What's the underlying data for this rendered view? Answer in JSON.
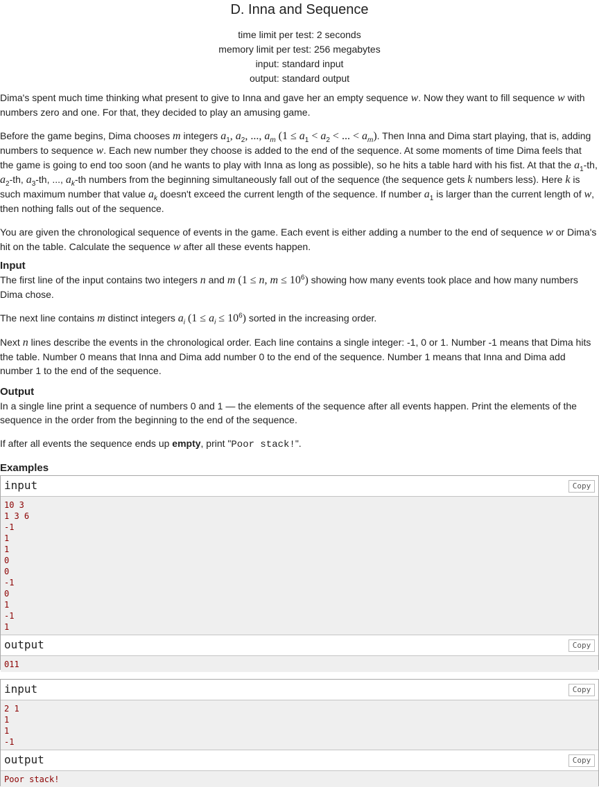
{
  "header": {
    "title": "D. Inna and Sequence",
    "time_limit": "time limit per test: 2 seconds",
    "memory_limit": "memory limit per test: 256 megabytes",
    "input": "input: standard input",
    "output": "output: standard output"
  },
  "statement": {
    "p1_a": "Dima's spent much time thinking what present to give to Inna and gave her an empty sequence ",
    "p1_b": ". Now they want to fill sequence ",
    "p1_c": " with numbers zero and one. For that, they decided to play an amusing game.",
    "p2_a": "Before the game begins, Dima chooses ",
    "p2_b": " integers ",
    "p2_c": ". Then Inna and Dima start playing, that is, adding numbers to sequence ",
    "p2_d": ". Each new number they choose is added to the end of the sequence. At some moments of time Dima feels that the game is going to end too soon (and he wants to play with Inna as long as possible), so he hits a table hard with his fist. At that the ",
    "p2_e": "-th, ",
    "p2_f": "-th, ",
    "p2_g": "-th, ..., ",
    "p2_h": "-th numbers from the beginning simultaneously fall out of the sequence (the sequence gets ",
    "p2_i": " numbers less). Here ",
    "p2_j": " is such maximum number that value ",
    "p2_k": " doesn't exceed the current length of the sequence. If number ",
    "p2_l": " is larger than the current length of ",
    "p2_m": ", then nothing falls out of the sequence.",
    "p3_a": "You are given the chronological sequence of events in the game. Each event is either adding a number to the end of sequence ",
    "p3_b": " or Dima's hit on the table. Calculate the sequence ",
    "p3_c": " after all these events happen."
  },
  "input_section": {
    "title": "Input",
    "p1_a": "The first line of the input contains two integers ",
    "p1_b": " and ",
    "p1_c": " showing how many events took place and how many numbers Dima chose.",
    "p2_a": "The next line contains ",
    "p2_b": " distinct integers ",
    "p2_c": " sorted in the increasing order.",
    "p3_a": "Next ",
    "p3_b": " lines describe the events in the chronological order. Each line contains a single integer: -1, 0 or 1. Number -1 means that Dima hits the table. Number 0 means that Inna and Dima add number 0 to the end of the sequence. Number 1 means that Inna and Dima add number 1 to the end of the sequence."
  },
  "output_section": {
    "title": "Output",
    "p1": "In a single line print a sequence of numbers 0 and 1 — the elements of the sequence after all events happen. Print the elements of the sequence in the order from the beginning to the end of the sequence.",
    "p2_a": "If after all events the sequence ends up ",
    "p2_b": "empty",
    "p2_c": ", print \"",
    "p2_d": "Poor stack!",
    "p2_e": "\"."
  },
  "examples": {
    "title": "Examples",
    "copy_label": "Copy",
    "input_label": "input",
    "output_label": "output",
    "ex1_input": [
      "10 3",
      "1 3 6",
      "-1",
      "1",
      "1",
      "0",
      "0",
      "-1",
      "0",
      "1",
      "-1",
      "1"
    ],
    "ex1_output": [
      "011"
    ],
    "ex2_input": [
      "2 1",
      "1",
      "1",
      "-1"
    ],
    "ex2_output": [
      "Poor stack!"
    ]
  }
}
